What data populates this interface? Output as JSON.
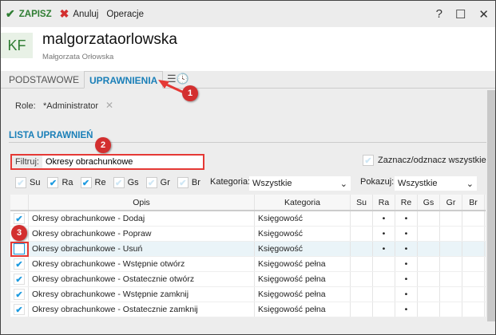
{
  "toolbar": {
    "save": "ZAPISZ",
    "cancel": "Anuluj",
    "operations": "Operacje",
    "help": "?",
    "maximize": "☐",
    "close": "✕"
  },
  "header": {
    "initials": "KF",
    "username": "malgorzataorlowska",
    "fullname": "Małgorzata Orłowska"
  },
  "tabs": [
    {
      "label": "PODSTAWOWE"
    },
    {
      "label": "UPRAWNIENIA",
      "active": true
    }
  ],
  "roles": {
    "label": "Role:",
    "value": "*Administrator"
  },
  "list_title": "LISTA UPRAWNIEŃ",
  "filter": {
    "label": "Filtruj:",
    "value": "Okresy obrachunkowe"
  },
  "select_all": "Zaznacz/odznacz wszystkie",
  "flags": [
    {
      "label": "Su",
      "checked": false
    },
    {
      "label": "Ra",
      "checked": true
    },
    {
      "label": "Re",
      "checked": true
    },
    {
      "label": "Gs",
      "checked": false
    },
    {
      "label": "Gr",
      "checked": false
    },
    {
      "label": "Br",
      "checked": false
    }
  ],
  "category": {
    "label": "Kategoria:",
    "value": "Wszystkie"
  },
  "show": {
    "label": "Pokazuj:",
    "value": "Wszystkie"
  },
  "columns": [
    "Opis",
    "Kategoria",
    "Su",
    "Ra",
    "Re",
    "Gs",
    "Gr",
    "Br"
  ],
  "rows": [
    {
      "checked": true,
      "opis": "Okresy obrachunkowe - Dodaj",
      "kat": "Księgowość",
      "flags": [
        "",
        "•",
        "•",
        "",
        "",
        ""
      ]
    },
    {
      "checked": true,
      "opis": "Okresy obrachunkowe - Popraw",
      "kat": "Księgowość",
      "flags": [
        "",
        "•",
        "•",
        "",
        "",
        ""
      ]
    },
    {
      "checked": false,
      "opis": "Okresy obrachunkowe - Usuń",
      "kat": "Księgowość",
      "flags": [
        "",
        "•",
        "•",
        "",
        "",
        ""
      ]
    },
    {
      "checked": true,
      "opis": "Okresy obrachunkowe - Wstępnie otwórz",
      "kat": "Księgowość pełna",
      "flags": [
        "",
        "",
        "•",
        "",
        "",
        ""
      ]
    },
    {
      "checked": true,
      "opis": "Okresy obrachunkowe - Ostatecznie otwórz",
      "kat": "Księgowość pełna",
      "flags": [
        "",
        "",
        "•",
        "",
        "",
        ""
      ]
    },
    {
      "checked": true,
      "opis": "Okresy obrachunkowe - Wstępnie zamknij",
      "kat": "Księgowość pełna",
      "flags": [
        "",
        "",
        "•",
        "",
        "",
        ""
      ]
    },
    {
      "checked": true,
      "opis": "Okresy obrachunkowe - Ostatecznie zamknij",
      "kat": "Księgowość pełna",
      "flags": [
        "",
        "",
        "•",
        "",
        "",
        ""
      ]
    }
  ],
  "badges": [
    "1",
    "2",
    "3"
  ],
  "colors": {
    "accent": "#1a7fb8",
    "save": "#2e7d32",
    "cancel": "#d32f2f",
    "badge": "#d32f2f"
  }
}
